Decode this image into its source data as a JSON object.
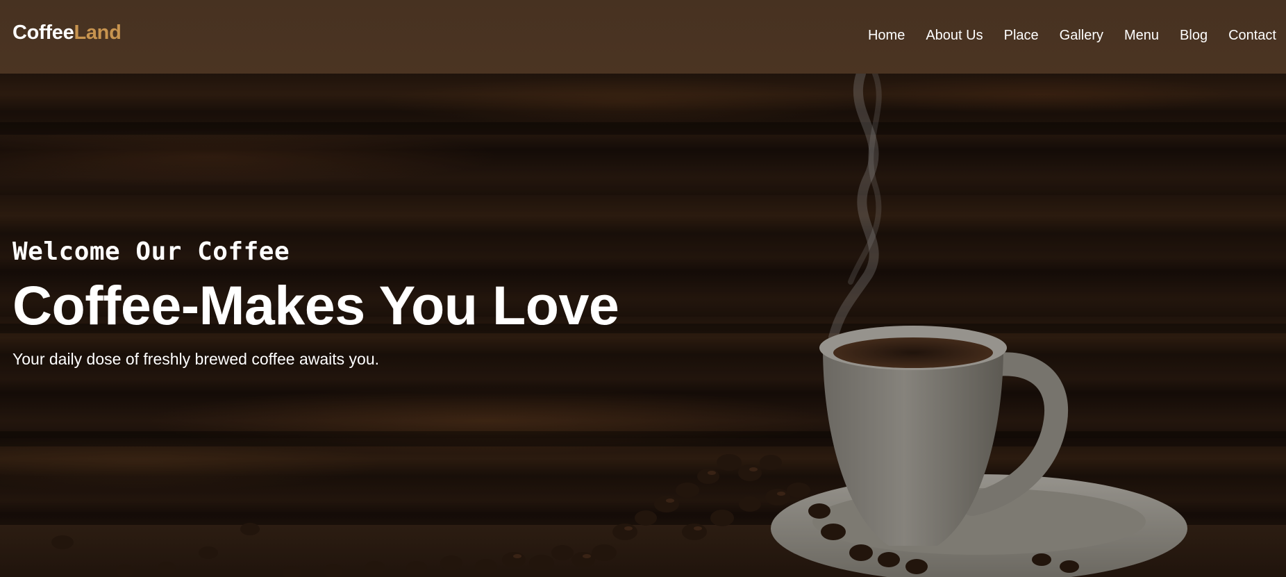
{
  "brand": {
    "name_part1": "Coffee",
    "name_part2": "Land",
    "accent_color": "#c8944f"
  },
  "nav": {
    "items": [
      {
        "label": "Home"
      },
      {
        "label": "About Us"
      },
      {
        "label": "Place"
      },
      {
        "label": "Gallery"
      },
      {
        "label": "Menu"
      },
      {
        "label": "Blog"
      },
      {
        "label": "Contact"
      }
    ]
  },
  "hero": {
    "kicker": "Welcome Our Coffee",
    "title": "Coffee-Makes You Love",
    "subtitle": "Your daily dose of freshly brewed coffee awaits you."
  },
  "colors": {
    "header_bg": "#473221",
    "text": "#ffffff"
  }
}
